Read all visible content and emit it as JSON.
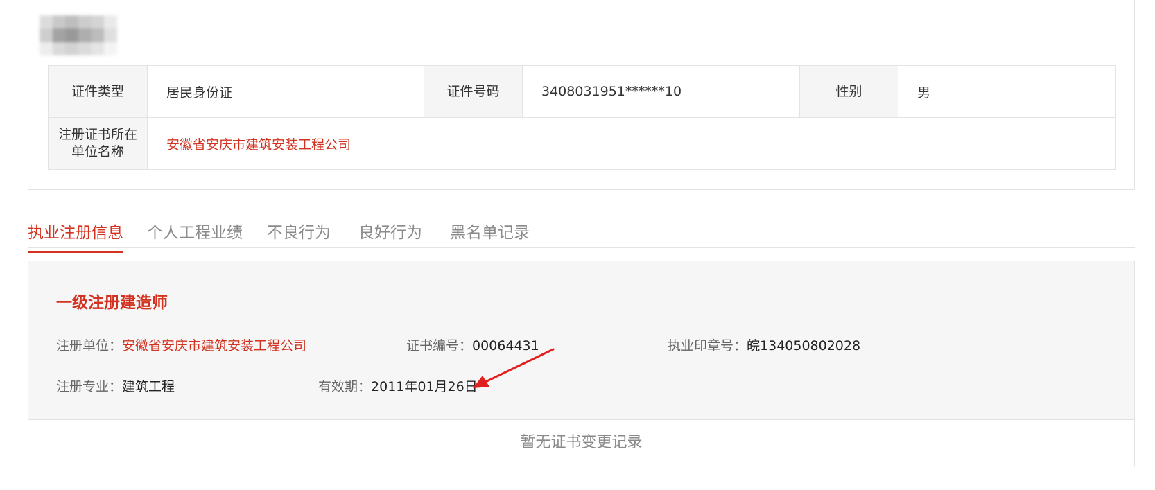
{
  "profile": {
    "id_type_label": "证件类型",
    "id_type_value": "居民身份证",
    "id_number_label": "证件号码",
    "id_number_value": "3408031951******10",
    "gender_label": "性别",
    "gender_value": "男",
    "company_label_line1": "注册证书所在",
    "company_label_line2": "单位名称",
    "company_value": "安徽省安庆市建筑安装工程公司"
  },
  "tabs": [
    {
      "label": "执业注册信息",
      "active": true
    },
    {
      "label": "个人工程业绩",
      "active": false
    },
    {
      "label": "不良行为",
      "active": false
    },
    {
      "label": "良好行为",
      "active": false
    },
    {
      "label": "黑名单记录",
      "active": false
    }
  ],
  "registration": {
    "title": "一级注册建造师",
    "unit_label": "注册单位：",
    "unit_value": "安徽省安庆市建筑安装工程公司",
    "cert_no_label": "证书编号：",
    "cert_no_value": "00064431",
    "seal_no_label": "执业印章号：",
    "seal_no_value": "皖134050802028",
    "specialty_label": "注册专业：",
    "specialty_value": "建筑工程",
    "validity_label": "有效期：",
    "validity_value": "2011年01月26日"
  },
  "change_record_empty": "暂无证书变更记录",
  "colors": {
    "accent": "#d2321f",
    "label_bg": "#f5f5f5",
    "panel_bg": "#f6f6f6",
    "border": "#e3e3e3",
    "muted_text": "#8a8a8a"
  },
  "icons": {
    "arrow": "red-arrow-annotation"
  }
}
